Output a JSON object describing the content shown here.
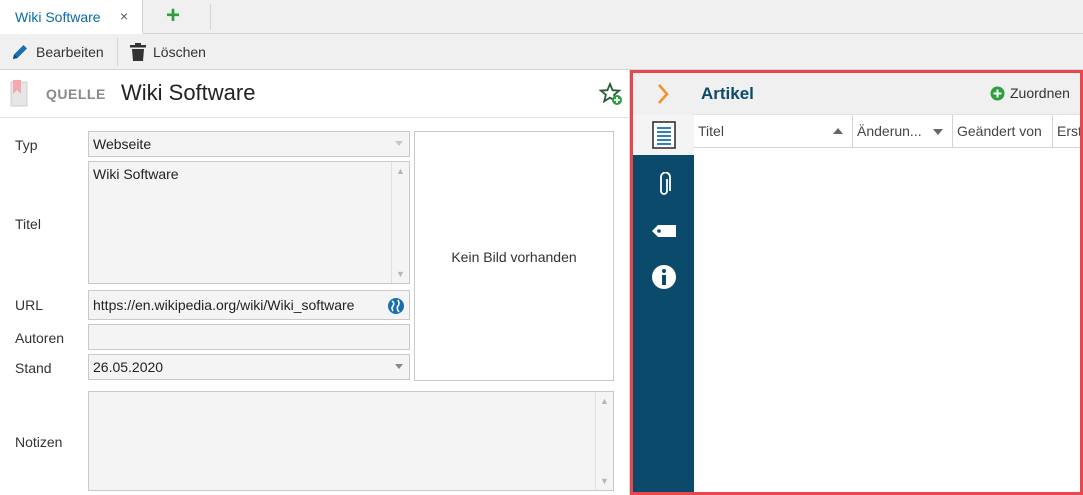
{
  "tabs": [
    {
      "label": "Wiki Software",
      "close_icon": "×"
    }
  ],
  "tab_add_icon": "+",
  "toolbar": {
    "edit_label": "Bearbeiten",
    "delete_label": "Löschen"
  },
  "record": {
    "kind_label": "QUELLE",
    "title": "Wiki Software"
  },
  "form": {
    "type_label": "Typ",
    "type_value": "Webseite",
    "title_label": "Titel",
    "title_value": "Wiki Software",
    "url_label": "URL",
    "url_value": "https://en.wikipedia.org/wiki/Wiki_software",
    "authors_label": "Autoren",
    "authors_value": "",
    "date_label": "Stand",
    "date_value": "26.05.2020",
    "notes_label": "Notizen",
    "notes_value": ""
  },
  "image_placeholder": "Kein Bild vorhanden",
  "panel": {
    "title": "Artikel",
    "assign_label": "Zuordnen",
    "columns": [
      "Titel",
      "Änderun...",
      "Geändert von",
      "Erst"
    ]
  },
  "colors": {
    "accent": "#0b4a6b",
    "highlight_border": "#e8474d",
    "add_green": "#2e9e3e",
    "tab_text": "#0a6aa8",
    "chevron_orange": "#f0932b"
  },
  "icons": {
    "edit": "pencil-icon",
    "delete": "trash-icon",
    "quelle": "bookmark-icon",
    "favorite": "star-add-icon",
    "url": "globe-icon",
    "collapse": "chevron-right-icon",
    "articles": "document-list-icon",
    "attachments": "paperclip-icon",
    "tags": "tag-icon",
    "info": "info-icon",
    "assign": "plus-circle-icon"
  }
}
